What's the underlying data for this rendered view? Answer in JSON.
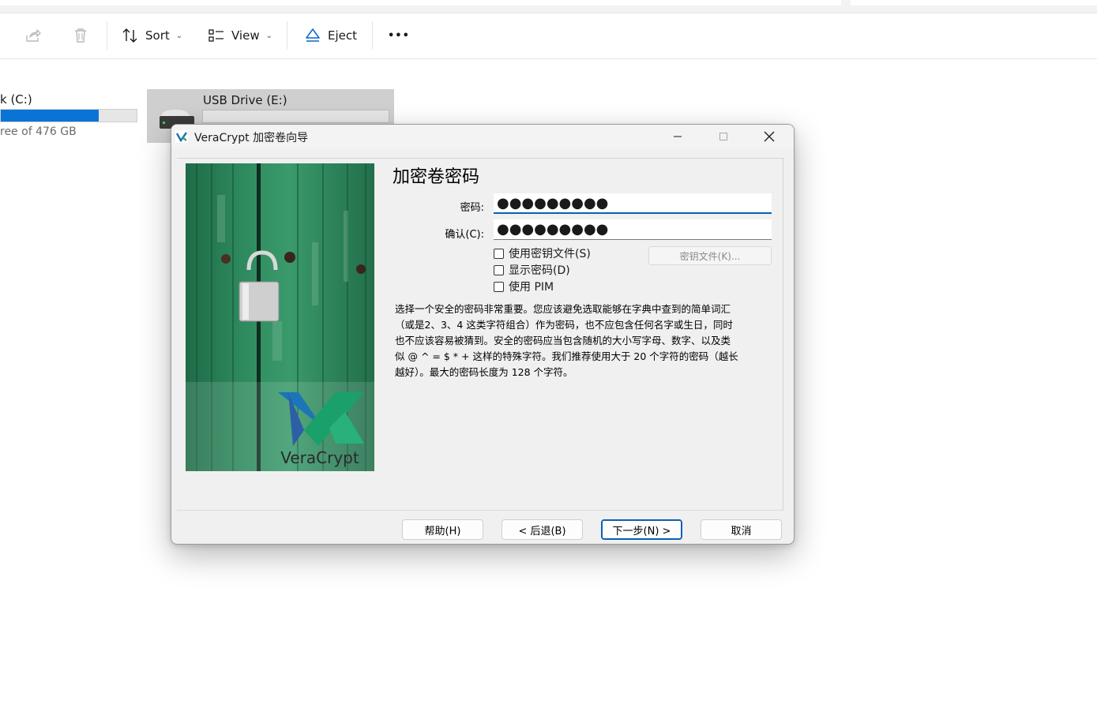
{
  "explorer": {
    "toolbar": {
      "share_icon": "share-icon",
      "delete_icon": "trash-icon",
      "sort_label": "Sort",
      "view_label": "View",
      "eject_label": "Eject",
      "more_label": "•••"
    },
    "drive_c": {
      "name": "k (C:)",
      "free_text": "ree of 476 GB",
      "usage_fraction": 0.72
    },
    "usb_drive": {
      "name": "USB Drive (E:)"
    }
  },
  "dialog": {
    "title": "VeraCrypt 加密卷向导",
    "heading": "加密卷密码",
    "password_label": "密码:",
    "password_value": "●●●●●●●●●",
    "confirm_label": "确认(C):",
    "confirm_value": "●●●●●●●●●",
    "use_keyfiles_label": "使用密钥文件(S)",
    "show_password_label": "显示密码(D)",
    "use_pim_label": "使用 PIM",
    "keyfiles_button": "密钥文件(K)...",
    "info_lines": [
      "选择一个安全的密码非常重要。您应该避免选取能够在字典中查到的简单词汇",
      "（或是2、3、4 这类字符组合）作为密码，也不应包含任何名字或生日，同时",
      "也不应该容易被猜到。安全的密码应当包含随机的大小写字母、数字、以及类",
      "似 @ ^ = $ * + 这样的特殊字符。我们推荐使用大于 20 个字符的密码（越长",
      "越好）。最大的密码长度为 128 个字符。"
    ],
    "image_brand": "VeraCrypt",
    "buttons": {
      "help": "帮助(H)",
      "back": "< 后退(B)",
      "next": "下一步(N) >",
      "cancel": "取消"
    },
    "accent_color": "#0a5fb4"
  }
}
